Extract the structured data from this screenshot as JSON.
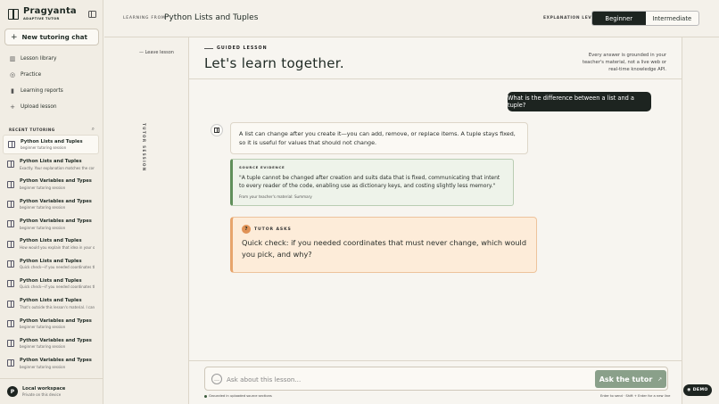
{
  "sidebar": {
    "brand_name": "Pragyanta",
    "brand_sub": "ADAPTIVE TUTOR",
    "new_chat": "New tutoring chat",
    "nav": [
      {
        "label": "Lesson library",
        "icon": "book-icon"
      },
      {
        "label": "Practice",
        "icon": "target-icon"
      },
      {
        "label": "Learning reports",
        "icon": "chart-icon"
      },
      {
        "label": "Upload lesson",
        "icon": "plus-icon"
      }
    ],
    "recent_title": "RECENT TUTORING",
    "recent": [
      {
        "title": "Python Lists and Tuples",
        "sub": "beginner tutoring session"
      },
      {
        "title": "Python Lists and Tuples",
        "sub": "Exactly. Your explanation matches the core"
      },
      {
        "title": "Python Variables and Types",
        "sub": "beginner tutoring session"
      },
      {
        "title": "Python Variables and Types",
        "sub": "beginner tutoring session"
      },
      {
        "title": "Python Variables and Types",
        "sub": "beginner tutoring session"
      },
      {
        "title": "Python Lists and Tuples",
        "sub": "How would you explain that idea in your own"
      },
      {
        "title": "Python Lists and Tuples",
        "sub": "Quick check—if you needed coordinates that"
      },
      {
        "title": "Python Lists and Tuples",
        "sub": "Quick check—if you needed coordinates that"
      },
      {
        "title": "Python Lists and Tuples",
        "sub": "That's outside this lesson's material. I can"
      },
      {
        "title": "Python Variables and Types",
        "sub": "beginner tutoring session"
      },
      {
        "title": "Python Variables and Types",
        "sub": "beginner tutoring session"
      },
      {
        "title": "Python Variables and Types",
        "sub": "beginner tutoring session"
      }
    ],
    "workspace_avatar": "P",
    "workspace_name": "Local workspace",
    "workspace_desc": "Private on this device"
  },
  "header": {
    "learning_from": "LEARNING FROM",
    "title": "Python Lists and Tuples",
    "level_label": "EXPLANATION LEVEL",
    "levels": [
      "Beginner",
      "Intermediate"
    ],
    "selected_level": "Beginner"
  },
  "rail": {
    "leave": "Leave lesson",
    "vertical": "TUTOR SESSION"
  },
  "main": {
    "guided_label": "GUIDED LESSON",
    "hero": "Let's learn together.",
    "note": "Every answer is grounded in your teacher's material, not a live web or real-time knowledge API.",
    "user_message": "What is the difference between a list and a tuple?",
    "answer": "A list can change after you create it—you can add, remove, or replace items. A tuple stays fixed, so it is useful for values that should not change.",
    "evidence_label": "SOURCE EVIDENCE",
    "evidence_quote": "\"A tuple cannot be changed after creation and suits data that is fixed, communicating that intent to every reader of the code, enabling use as dictionary keys, and costing slightly less memory.\"",
    "evidence_source": "From your teacher's material: Summary",
    "ask_badge": "?",
    "ask_label": "TUTOR ASKS",
    "ask_question": "Quick check: if you needed coordinates that must never change, which would you pick, and why?"
  },
  "composer": {
    "plus": "…",
    "placeholder": "Ask about this lesson...",
    "button": "Ask the tutor",
    "grounded": "Grounded in uploaded source sections",
    "hint": "Enter to send · Shift + Enter for a new line"
  },
  "demo": "DEMO",
  "colors": {
    "dark": "#1d2420",
    "evidence_accent": "#5f8f5a",
    "ask_accent": "#e7a46b",
    "button": "#8aa08a"
  }
}
